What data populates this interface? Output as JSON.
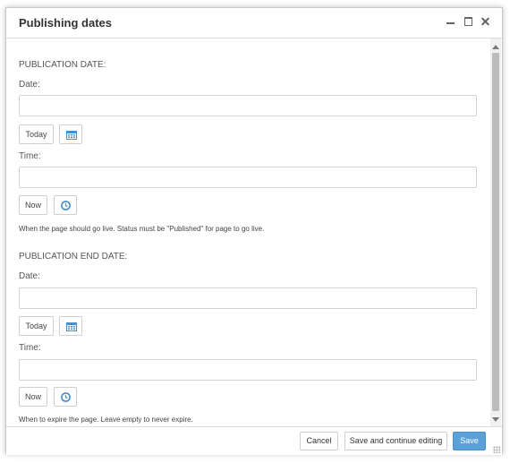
{
  "dialog": {
    "title": "Publishing dates"
  },
  "publication": {
    "section_label": "PUBLICATION DATE:",
    "date_label": "Date:",
    "date_value": "",
    "today_label": "Today",
    "calendar_icon": "calendar-icon",
    "time_label": "Time:",
    "time_value": "",
    "now_label": "Now",
    "clock_icon": "clock-icon",
    "help_text": "When the page should go live. Status must be \"Published\" for page to go live."
  },
  "publication_end": {
    "section_label": "PUBLICATION END DATE:",
    "date_label": "Date:",
    "date_value": "",
    "today_label": "Today",
    "calendar_icon": "calendar-icon",
    "time_label": "Time:",
    "time_value": "",
    "now_label": "Now",
    "clock_icon": "clock-icon",
    "help_text": "When to expire the page. Leave empty to never expire."
  },
  "footer": {
    "cancel_label": "Cancel",
    "save_continue_label": "Save and continue editing",
    "save_label": "Save"
  },
  "colors": {
    "primary": "#5ba0d6",
    "icon_blue": "#4a8fc9",
    "border": "#d3d3d3"
  }
}
